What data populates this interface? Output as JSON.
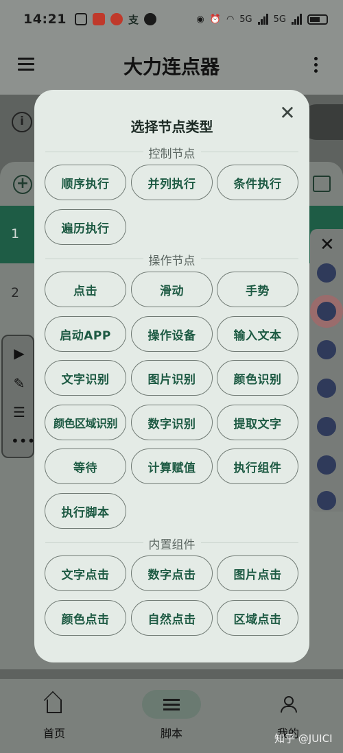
{
  "status_bar": {
    "time": "14:21",
    "left_text_icon": "支",
    "net1": "5G",
    "net2": "5G"
  },
  "app_bar": {
    "title": "大力连点器"
  },
  "background": {
    "row1_index": "1",
    "row2_index": "2"
  },
  "dialog": {
    "title": "选择节点类型",
    "sections": [
      {
        "label": "控制节点",
        "items": [
          "顺序执行",
          "并列执行",
          "条件执行",
          "遍历执行"
        ]
      },
      {
        "label": "操作节点",
        "items": [
          "点击",
          "滑动",
          "手势",
          "启动APP",
          "操作设备",
          "输入文本",
          "文字识别",
          "图片识别",
          "颜色识别",
          "颜色区域识别",
          "数字识别",
          "提取文字",
          "等待",
          "计算赋值",
          "执行组件",
          "执行脚本"
        ]
      },
      {
        "label": "内置组件",
        "items": [
          "文字点击",
          "数字点击",
          "图片点击",
          "颜色点击",
          "自然点击",
          "区域点击"
        ]
      }
    ]
  },
  "bottom_nav": {
    "items": [
      {
        "label": "首页",
        "icon": "home-icon"
      },
      {
        "label": "脚本",
        "icon": "list-icon",
        "active": true
      },
      {
        "label": "我的",
        "icon": "person-icon"
      }
    ]
  },
  "watermark": "知乎 @JUICI",
  "colors": {
    "scrim": "#5e625f",
    "dialog_bg": "#e4ebe6",
    "chip_text": "#1d5a43",
    "chip_border": "#707a74"
  }
}
